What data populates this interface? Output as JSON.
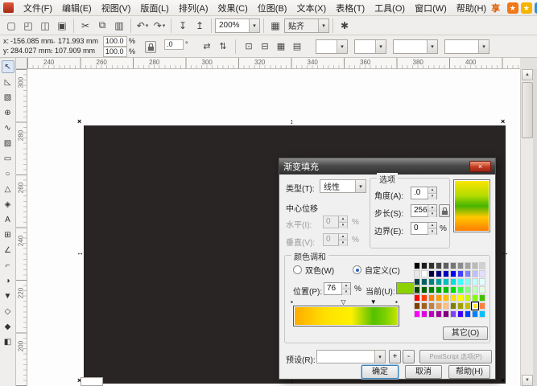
{
  "ui": {
    "spin_up": "▴",
    "spin_down": "▾",
    "combo_arrow": "▾",
    "scroll_up": "▲",
    "scroll_down": "▼"
  },
  "menu_bar": {
    "items": [
      {
        "key": "file",
        "label": "文件(F)"
      },
      {
        "key": "edit",
        "label": "编辑(E)"
      },
      {
        "key": "view",
        "label": "视图(V)"
      },
      {
        "key": "layout",
        "label": "版面(L)"
      },
      {
        "key": "arrange",
        "label": "排列(A)"
      },
      {
        "key": "effects",
        "label": "效果(C)"
      },
      {
        "key": "bitmaps",
        "label": "位图(B)"
      },
      {
        "key": "text",
        "label": "文本(X)"
      },
      {
        "key": "table",
        "label": "表格(T)"
      },
      {
        "key": "tools",
        "label": "工具(O)"
      },
      {
        "key": "window",
        "label": "窗口(W)"
      },
      {
        "key": "help",
        "label": "帮助(H)"
      }
    ],
    "share_label": "分享到:",
    "share_icons": [
      {
        "name": "share-star-orange-icon",
        "glyph": "★",
        "color": "#f07818"
      },
      {
        "name": "share-star-yellow-icon",
        "glyph": "★",
        "color": "#f5b400"
      },
      {
        "name": "share-blue-icon",
        "glyph": "✦",
        "color": "#3a8cd2"
      },
      {
        "name": "share-red-icon",
        "glyph": "■",
        "color": "#d93a28"
      }
    ]
  },
  "toolbar": {
    "icons": [
      {
        "name": "new-document-button",
        "glyph": "▢"
      },
      {
        "name": "open-button",
        "glyph": "◰"
      },
      {
        "name": "save-button",
        "glyph": "◫"
      },
      {
        "name": "print-button",
        "glyph": "▣"
      },
      {
        "sep": true
      },
      {
        "name": "cut-button",
        "glyph": "✂"
      },
      {
        "name": "copy-button",
        "glyph": "⧉"
      },
      {
        "name": "paste-button",
        "glyph": "▥"
      },
      {
        "sep": true
      },
      {
        "name": "undo-button",
        "glyph": "↶",
        "dropdown": true
      },
      {
        "name": "redo-button",
        "glyph": "↷",
        "dropdown": true
      },
      {
        "sep": true
      },
      {
        "name": "import-button",
        "glyph": "↧"
      },
      {
        "name": "export-button",
        "glyph": "↥"
      },
      {
        "sep": true
      }
    ],
    "zoom_value": "200%",
    "launcher_glyph": "▦",
    "snap_label": "贴齐",
    "options_glyph": "✱"
  },
  "property_bar": {
    "x_label": "x:",
    "x_value": "-156.085 mm",
    "y_label": "y:",
    "y_value": "284.027 mm",
    "width_value": "171.993 mm",
    "height_value": "107.909 mm",
    "scale_h_value": "100.0",
    "scale_v_value": "100.0",
    "percent": "%",
    "angle_value": ".0",
    "angle_unit": "°",
    "mirror_icons": [
      {
        "name": "mirror-horizontal-button",
        "glyph": "⇄"
      },
      {
        "name": "mirror-vertical-button",
        "glyph": "⇅"
      }
    ],
    "mid_icons": [
      {
        "name": "to-front-button",
        "glyph": "⊡"
      },
      {
        "name": "to-back-button",
        "glyph": "⊟"
      },
      {
        "name": "group-button",
        "glyph": "▦"
      },
      {
        "name": "weld-button",
        "glyph": "▤"
      }
    ],
    "combos": [
      {
        "name": "unit-combo",
        "value": ""
      },
      {
        "name": "nudge-combo",
        "value": ""
      },
      {
        "name": "duplicate-distance-combo",
        "value": ""
      },
      {
        "name": "outline-width-combo",
        "value": ""
      }
    ]
  },
  "rulers": {
    "h_ticks": [
      "240",
      "260",
      "280",
      "300",
      "320",
      "340",
      "360",
      "380",
      "400"
    ],
    "v_ticks": [
      "300",
      "280",
      "260",
      "240",
      "220",
      "200"
    ]
  },
  "toolbox": {
    "tools": [
      {
        "name": "pick-tool",
        "glyph": "↖"
      },
      {
        "name": "shape-tool",
        "glyph": "◺"
      },
      {
        "name": "crop-tool",
        "glyph": "▧"
      },
      {
        "name": "zoom-tool",
        "glyph": "⊕"
      },
      {
        "name": "freehand-tool",
        "glyph": "∿"
      },
      {
        "name": "smart-fill-tool",
        "glyph": "▨"
      },
      {
        "name": "rectangle-tool",
        "glyph": "▭"
      },
      {
        "name": "ellipse-tool",
        "glyph": "○"
      },
      {
        "name": "polygon-tool",
        "glyph": "△"
      },
      {
        "name": "basic-shapes-tool",
        "glyph": "◈"
      },
      {
        "name": "text-tool",
        "glyph": "A"
      },
      {
        "name": "table-tool",
        "glyph": "⊞"
      },
      {
        "name": "dimension-tool",
        "glyph": "∠"
      },
      {
        "name": "connector-tool",
        "glyph": "⌐"
      },
      {
        "name": "blend-tool",
        "glyph": "◑"
      },
      {
        "name": "eyedropper-tool",
        "glyph": "▼"
      },
      {
        "name": "outline-tool",
        "glyph": "◇"
      },
      {
        "name": "fill-tool",
        "glyph": "◆"
      },
      {
        "name": "interactive-fill-tool",
        "glyph": "◧"
      }
    ]
  },
  "canvas": {
    "object_fill": "#282524",
    "handle_corner_glyph": "×",
    "handle_vertical_glyph": "↕",
    "handle_horizontal_glyph": "↔"
  },
  "dialog": {
    "title": "渐变填充",
    "close_glyph": "×",
    "type_label": "类型(T):",
    "type_value": "线性",
    "options_label": "选项",
    "angle_label": "角度(A):",
    "angle_value": ".0",
    "steps_label": "步长(S):",
    "steps_value": "256",
    "edge_label": "边界(E):",
    "edge_value": "0",
    "percent": "%",
    "center_label": "中心位移",
    "horizontal_label": "水平(I):",
    "horizontal_value": "0",
    "vertical_label": "垂直(V):",
    "vertical_value": "0",
    "blend_label": "颜色调和",
    "two_color_label": "双色(W)",
    "custom_label": "自定义(C)",
    "position_label": "位置(P):",
    "position_value": "76",
    "current_label": "当前(U):",
    "current_color": "#8cd200",
    "others_button": "其它(O)",
    "presets_label": "预设(R):",
    "presets_value": "",
    "add_label": "+",
    "remove_label": "-",
    "postscript_button": "PostScript 选项(P)",
    "ok_button": "确定",
    "cancel_button": "取消",
    "help_button": "帮助(H)",
    "bar_stops": [
      {
        "pos": 0,
        "color": "#ffaa00"
      },
      {
        "pos": 30,
        "color": "#ffe000"
      },
      {
        "pos": 55,
        "color": "#fff000"
      },
      {
        "pos": 76,
        "color": "#55c000"
      },
      {
        "pos": 88,
        "color": "#7ed000"
      },
      {
        "pos": 100,
        "color": "#cfe600"
      }
    ],
    "preview_stops": [
      {
        "pos": 0,
        "color": "#ffe600"
      },
      {
        "pos": 30,
        "color": "#b4dc00"
      },
      {
        "pos": 50,
        "color": "#46b400"
      },
      {
        "pos": 72,
        "color": "#ffc800"
      },
      {
        "pos": 100,
        "color": "#ff7800"
      }
    ],
    "bar_markers": [
      {
        "pos": 0,
        "style": "square"
      },
      {
        "pos": 48,
        "style": "outline"
      },
      {
        "pos": 76,
        "style": "selected"
      },
      {
        "pos": 100,
        "style": "square"
      }
    ],
    "palette": {
      "selected": [
        5,
        8
      ],
      "rows": [
        [
          "#000000",
          "#1a1a1a",
          "#303030",
          "#474747",
          "#5e5e5e",
          "#757575",
          "#8c8c8c",
          "#a3a3a3",
          "#bababa",
          "#d1d1d1"
        ],
        [
          "#e8e8e8",
          "#ffffff",
          "#000040",
          "#000080",
          "#0000c0",
          "#0000ff",
          "#4040ff",
          "#8080ff",
          "#c0c0ff",
          "#e0e0ff"
        ],
        [
          "#004040",
          "#006060",
          "#008080",
          "#00a0a0",
          "#00c0c0",
          "#00e0e0",
          "#40ffff",
          "#80ffff",
          "#c0ffff",
          "#e0ffff"
        ],
        [
          "#004000",
          "#006000",
          "#008000",
          "#00a000",
          "#00c000",
          "#00e000",
          "#40ff40",
          "#80ff80",
          "#c0ffc0",
          "#e0ffe0"
        ],
        [
          "#ff0000",
          "#ff4000",
          "#ff8000",
          "#ffa000",
          "#ffc000",
          "#ffe000",
          "#ffff00",
          "#c0ff00",
          "#80ff00",
          "#40c000"
        ],
        [
          "#804000",
          "#a06020",
          "#c08040",
          "#e0a060",
          "#ffc080",
          "#808000",
          "#a0a000",
          "#c0c000",
          "#ffe600",
          "#ff8040"
        ],
        [
          "#ff00ff",
          "#e000e0",
          "#c000c0",
          "#a000a0",
          "#800080",
          "#8040ff",
          "#4000ff",
          "#0040ff",
          "#0080ff",
          "#00c0ff"
        ]
      ]
    }
  }
}
